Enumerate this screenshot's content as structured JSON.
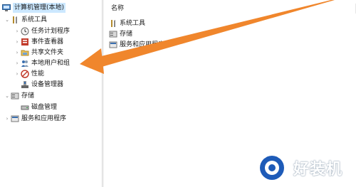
{
  "tree": {
    "root": {
      "label": "计算机管理(本地)",
      "icon": "computer-management-icon"
    },
    "items": [
      {
        "label": "系统工具",
        "icon": "system-tools-icon",
        "expanded": true
      },
      {
        "label": "任务计划程序",
        "icon": "clock-icon"
      },
      {
        "label": "事件查看器",
        "icon": "event-viewer-icon"
      },
      {
        "label": "共享文件夹",
        "icon": "shared-folder-icon"
      },
      {
        "label": "本地用户和组",
        "icon": "users-icon"
      },
      {
        "label": "性能",
        "icon": "performance-icon"
      },
      {
        "label": "设备管理器",
        "icon": "device-manager-icon"
      },
      {
        "label": "存储",
        "icon": "storage-icon",
        "expanded": true
      },
      {
        "label": "磁盘管理",
        "icon": "disk-icon"
      },
      {
        "label": "服务和应用程序",
        "icon": "services-icon",
        "expanded": false
      }
    ]
  },
  "list": {
    "header": "名称",
    "items": [
      {
        "label": "系统工具",
        "icon": "system-tools-icon"
      },
      {
        "label": "存储",
        "icon": "storage-icon"
      },
      {
        "label": "服务和应用程序",
        "icon": "services-icon"
      }
    ]
  },
  "annotation": {
    "arrow_color": "#f0862c"
  },
  "watermark": {
    "text": "好装机"
  }
}
